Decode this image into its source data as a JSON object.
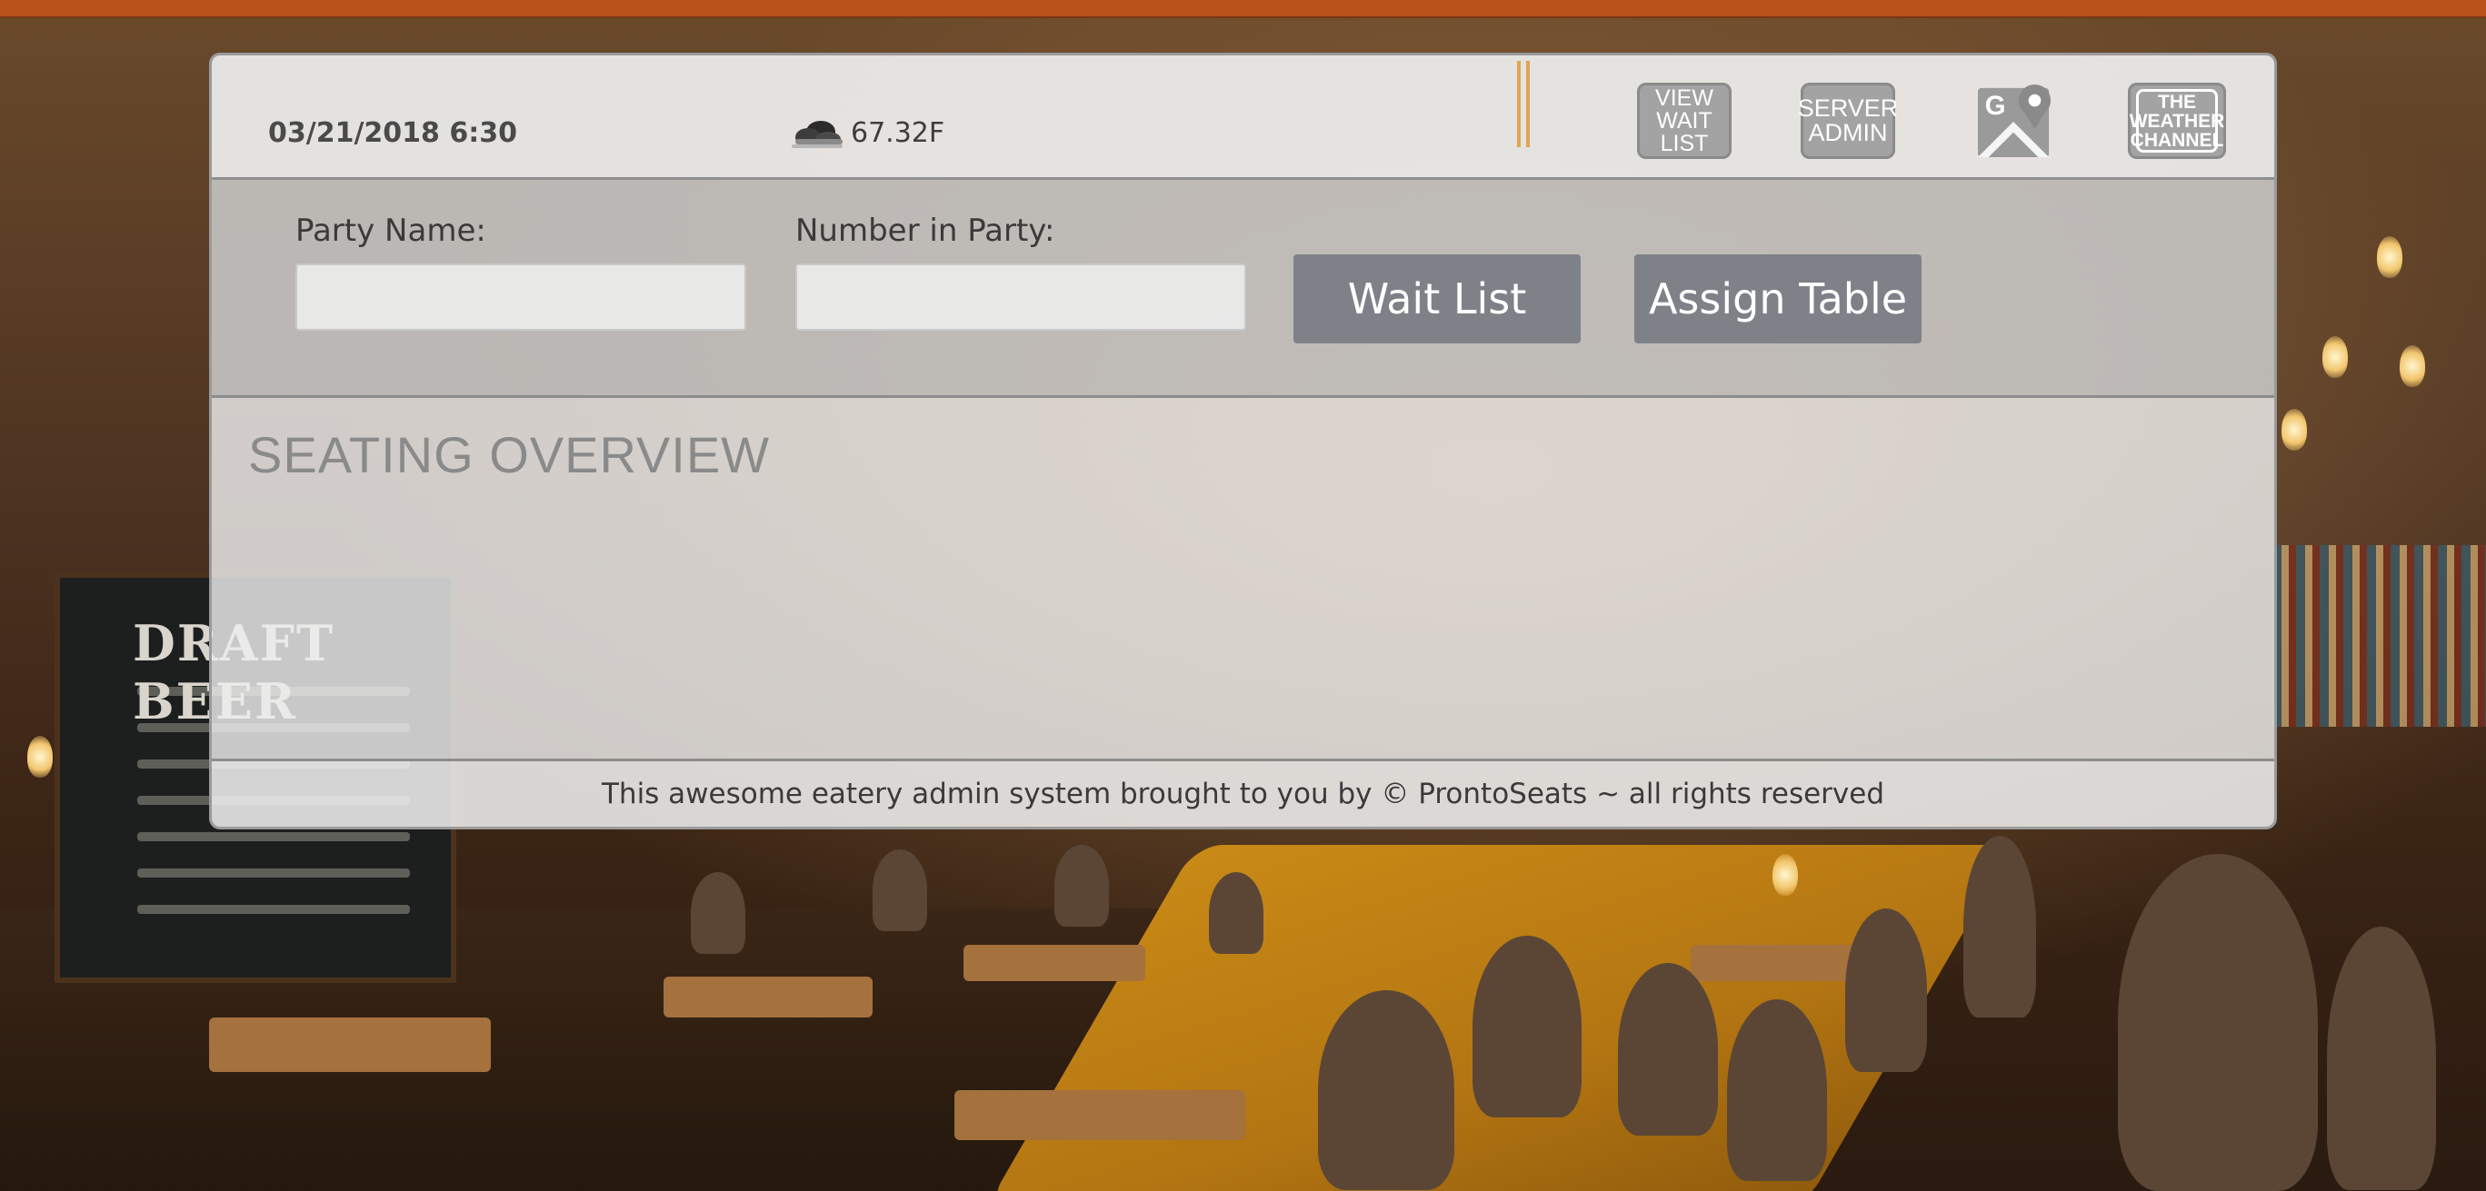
{
  "header": {
    "datetime": "03/21/2018 6:30",
    "weather_icon": "cloud-icon",
    "temperature": "67.32F",
    "buttons": {
      "view_wait_list": [
        "VIEW",
        "WAIT",
        "LIST"
      ],
      "server_admin": [
        "SERVER",
        "ADMIN"
      ],
      "maps_icon": "google-maps-icon",
      "weather_channel": [
        "THE",
        "WEATHER",
        "CHANNEL"
      ]
    }
  },
  "form": {
    "party_name_label": "Party Name:",
    "party_name_value": "",
    "party_count_label": "Number in Party:",
    "party_count_value": "",
    "wait_list_button": "Wait List",
    "assign_table_button": "Assign Table"
  },
  "overview": {
    "title": "SEATING OVERVIEW"
  },
  "footer": {
    "text": "This awesome eatery admin system brought to you by © ProntoSeats ~ all rights reserved"
  },
  "colors": {
    "accent_orange": "#b8531b",
    "button_gray": "#7e8188",
    "icon_button_gray": "#a3a3a3"
  }
}
